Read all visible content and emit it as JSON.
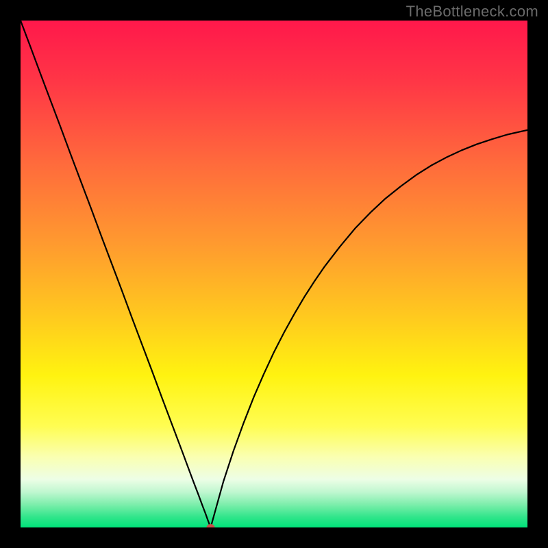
{
  "watermark": "TheBottleneck.com",
  "chart_data": {
    "type": "line",
    "title": "",
    "xlabel": "",
    "ylabel": "",
    "xlim": [
      0,
      100
    ],
    "ylim": [
      0,
      100
    ],
    "grid": false,
    "legend": false,
    "gradient_top_color": "#ff184b",
    "gradient_bottom_color": "#00e37a",
    "background_color": "#000000",
    "curve_color": "#000000",
    "curve_width": 2.2,
    "marker": {
      "x": 37.5,
      "y": 0,
      "color": "#c9504a",
      "rx": 6,
      "ry": 5
    },
    "x": [
      0,
      2,
      4,
      6,
      8,
      10,
      12,
      14,
      16,
      18,
      20,
      22,
      24,
      26,
      28,
      30,
      32,
      33,
      34,
      35,
      36,
      36.5,
      37,
      37.5,
      38,
      38.5,
      39,
      40,
      42,
      44,
      46,
      48,
      50,
      52,
      54,
      56,
      58,
      60,
      63,
      66,
      69,
      72,
      75,
      78,
      81,
      84,
      87,
      90,
      93,
      96,
      100
    ],
    "values": [
      100,
      94.7,
      89.3,
      84.0,
      78.7,
      73.3,
      68.0,
      62.7,
      57.3,
      52.0,
      46.7,
      41.3,
      36.0,
      30.7,
      25.3,
      20.0,
      14.7,
      12.0,
      9.3,
      6.7,
      4.0,
      2.7,
      1.3,
      0.0,
      1.8,
      3.6,
      5.4,
      9.0,
      15.1,
      20.6,
      25.7,
      30.3,
      34.6,
      38.5,
      42.1,
      45.5,
      48.6,
      51.5,
      55.4,
      59.0,
      62.1,
      64.9,
      67.3,
      69.5,
      71.4,
      73.0,
      74.4,
      75.6,
      76.6,
      77.5,
      78.4
    ],
    "gradient_stops": [
      {
        "offset": 0.0,
        "color": "#ff184b"
      },
      {
        "offset": 0.12,
        "color": "#ff3646"
      },
      {
        "offset": 0.28,
        "color": "#ff6a3c"
      },
      {
        "offset": 0.44,
        "color": "#ff9a2f"
      },
      {
        "offset": 0.58,
        "color": "#ffc81f"
      },
      {
        "offset": 0.7,
        "color": "#fff310"
      },
      {
        "offset": 0.8,
        "color": "#fffd52"
      },
      {
        "offset": 0.86,
        "color": "#faffb0"
      },
      {
        "offset": 0.905,
        "color": "#edfee6"
      },
      {
        "offset": 0.93,
        "color": "#c0f7d0"
      },
      {
        "offset": 0.955,
        "color": "#7ceeab"
      },
      {
        "offset": 0.98,
        "color": "#2fe58a"
      },
      {
        "offset": 1.0,
        "color": "#00e37a"
      }
    ]
  }
}
